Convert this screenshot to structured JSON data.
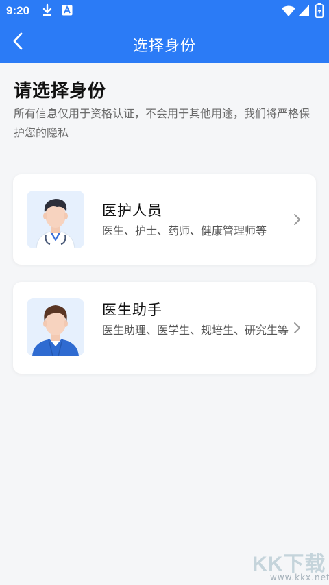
{
  "status_bar": {
    "time": "9:20",
    "icons": [
      "download-icon",
      "app-notification-icon",
      "wifi-icon",
      "signal-icon",
      "battery-icon"
    ]
  },
  "header": {
    "back_icon": "chevron-left-icon",
    "title": "选择身份"
  },
  "main": {
    "title": "请选择身份",
    "description": "所有信息仅用于资格认证，不会用于其他用途，我们将严格保护您的隐私"
  },
  "options": [
    {
      "title": "医护人员",
      "subtitle": "医生、护士、药师、健康管理师等",
      "avatar_icon": "doctor-avatar-icon",
      "chevron_icon": "chevron-right-icon"
    },
    {
      "title": "医生助手",
      "subtitle": "医生助理、医学生、规培生、研究生等",
      "avatar_icon": "assistant-avatar-icon",
      "chevron_icon": "chevron-right-icon"
    }
  ],
  "watermark": {
    "logo": "KK下载",
    "url": "www.kkx.net"
  },
  "colors": {
    "primary": "#2b7bf6",
    "background": "#f5f6f8",
    "card": "#ffffff",
    "text_primary": "#111111",
    "text_secondary": "#6b6b6b"
  }
}
